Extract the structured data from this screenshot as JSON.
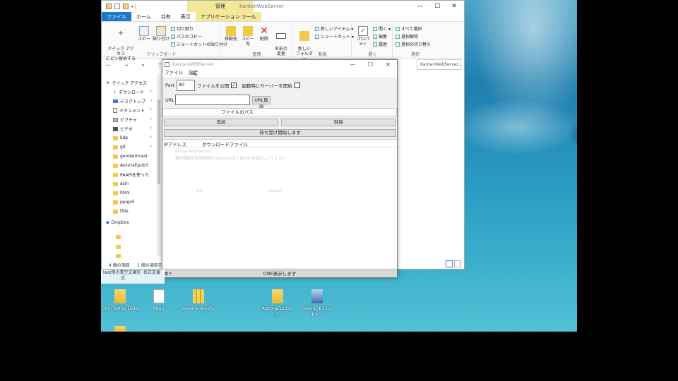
{
  "explorer": {
    "manage_tab": "管理",
    "title": "KantanWebServer",
    "window_controls": [
      "—",
      "☐",
      "✕"
    ],
    "tabs": [
      "ファイル",
      "ホーム",
      "共有",
      "表示",
      "アプリケーション ツール"
    ],
    "ribbon": {
      "clipboard": {
        "label": "クリップボード",
        "pin_quick": "クイック アクセス\nにピン留めする",
        "copy": "コピー",
        "paste": "貼り付け",
        "cut": "切り取り",
        "copy_path": "パスのコピー",
        "paste_shortcut": "ショートカットの貼り付け"
      },
      "organize": {
        "label": "整理",
        "move_to": "移動先",
        "copy_to": "コピー先",
        "delete": "削除",
        "rename": "名前の\n変更"
      },
      "new": {
        "label": "新規",
        "new_folder": "新しい\nフォルダー",
        "new_item": "新しいアイテム ▾",
        "shortcut": "ショートカット ▾"
      },
      "open": {
        "label": "開く",
        "properties": "プロパティ",
        "open": "開く ▾",
        "edit": "編集",
        "history": "履歴"
      },
      "select": {
        "label": "選択",
        "select_all": "すべて選択",
        "select_none": "選択解除",
        "invert": "選択の切り替え"
      }
    },
    "nav_arrows": "← → ▾ ↑",
    "search_placeholder": "KantanWebServer...",
    "nav_items": [
      {
        "label": "クイック アクセス",
        "icon": "star-icon"
      },
      {
        "label": "ダウンロード",
        "icon": "download-icon"
      },
      {
        "label": "デスクトップ",
        "icon": "desktop-icon"
      },
      {
        "label": "ドキュメント",
        "icon": "document-icon"
      },
      {
        "label": "ピクチャ",
        "icon": "picture-icon"
      },
      {
        "label": "ビデオ",
        "icon": "video-icon"
      },
      {
        "label": "kdp",
        "icon": "folder-icon"
      },
      {
        "label": "git",
        "icon": "folder-icon"
      },
      {
        "label": "gendaimusoi",
        "icon": "folder-icon"
      },
      {
        "label": "AozoraEpub3",
        "icon": "folder-icon"
      },
      {
        "label": "PAAPIを使った",
        "icon": "folder-icon"
      },
      {
        "label": "asin",
        "icon": "folder-icon"
      },
      {
        "label": "html",
        "icon": "folder-icon"
      },
      {
        "label": "ppapi5",
        "icon": "folder-icon"
      },
      {
        "label": "title",
        "icon": "folder-icon"
      },
      {
        "label": "Dropbox",
        "icon": "dropbox-icon"
      }
    ],
    "status_left": "4 個の項目",
    "status_selected": "1 個の項目を"
  },
  "kantan": {
    "title": "KantanWEBServer",
    "window_controls": [
      "—",
      "☐",
      "✕"
    ],
    "menu": [
      "ファイル",
      "設定"
    ],
    "port_label": "Port",
    "port_value": "80",
    "publish_label": "ファイルを公開",
    "publish_checked": true,
    "start_label": "起動時にサーバーを開始",
    "start_checked": false,
    "url_label": "URL",
    "url_value": "",
    "url_button": "URL取得",
    "filepath_header": "ファイルのパス",
    "add_button": "追加",
    "delete_button": "削除",
    "listen_button": "待ち受け開始します",
    "col_ip": "IPアドレス",
    "col_download": "ダウンロードファイル",
    "ghost_dialog": {
      "title": "KantanWEBServer",
      "message": "選択範囲の有効期限をDirectoryまたはURLを指定してください",
      "ok": "OK",
      "cancel": "Cancel"
    },
    "status_left": "本",
    "status_text": "CME表示します"
  },
  "taskbar_strip": {
    "line1": "test用の青空文庫形",
    "line2": "式",
    "line3": "校正支援"
  },
  "desktop_icons": [
    {
      "label": "Old Firefox Data",
      "type": "folder"
    },
    {
      "label": "Mery",
      "type": "doc"
    },
    {
      "label": "aozoramsy.zip",
      "type": "zip"
    },
    {
      "label": "AozoraEpub3-1.1...",
      "type": "folder"
    },
    {
      "label": "OpenJDK11U-jre...",
      "type": "java"
    }
  ]
}
